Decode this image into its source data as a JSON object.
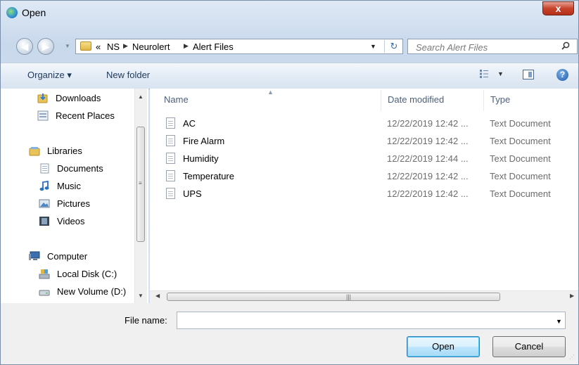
{
  "window": {
    "title": "Open",
    "close_label": "x"
  },
  "address": {
    "overflow": "«",
    "crumbs": [
      "NS",
      "Neurolert",
      "Alert Files"
    ],
    "search_placeholder": "Search Alert Files"
  },
  "toolbar": {
    "organize": "Organize ▾",
    "new_folder": "New folder"
  },
  "nav": {
    "downloads": "Downloads",
    "recent": "Recent Places",
    "libraries": "Libraries",
    "documents": "Documents",
    "music": "Music",
    "pictures": "Pictures",
    "videos": "Videos",
    "computer": "Computer",
    "local_disk": "Local Disk (C:)",
    "new_volume": "New Volume (D:)"
  },
  "columns": {
    "name": "Name",
    "date": "Date modified",
    "type": "Type"
  },
  "files": [
    {
      "name": "AC",
      "date": "12/22/2019 12:42 ...",
      "type": "Text Document"
    },
    {
      "name": "Fire Alarm",
      "date": "12/22/2019 12:42 ...",
      "type": "Text Document"
    },
    {
      "name": "Humidity",
      "date": "12/22/2019 12:44 ...",
      "type": "Text Document"
    },
    {
      "name": "Temperature",
      "date": "12/22/2019 12:42 ...",
      "type": "Text Document"
    },
    {
      "name": "UPS",
      "date": "12/22/2019 12:42 ...",
      "type": "Text Document"
    }
  ],
  "footer": {
    "file_name_label": "File name:",
    "file_name_value": "",
    "open": "Open",
    "cancel": "Cancel"
  }
}
